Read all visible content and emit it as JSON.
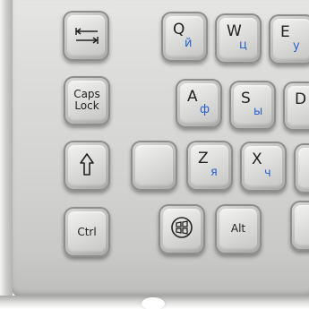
{
  "keyboard": {
    "keys": {
      "tab": {
        "icon": "tab-arrows-icon"
      },
      "q": {
        "primary": "Q",
        "secondary": "й"
      },
      "w": {
        "primary": "W",
        "secondary": "ц"
      },
      "e": {
        "primary": "E",
        "secondary": "у"
      },
      "caps": {
        "line1": "Caps",
        "line2": "Lock"
      },
      "a": {
        "primary": "A",
        "secondary": "ф"
      },
      "s": {
        "primary": "S",
        "secondary": "ы"
      },
      "d": {
        "primary": "D"
      },
      "shift": {
        "icon": "shift-arrow-icon"
      },
      "blank": {},
      "z": {
        "primary": "Z",
        "secondary": "я"
      },
      "x": {
        "primary": "X",
        "secondary": "ч"
      },
      "ctrl": {
        "label": "Ctrl"
      },
      "win": {
        "icon": "windows-logo-icon"
      },
      "alt": {
        "label": "Alt"
      }
    },
    "colors": {
      "steel": "#d4d4d2",
      "legend": "#222222",
      "cyrillic": "#2a63c9"
    }
  }
}
